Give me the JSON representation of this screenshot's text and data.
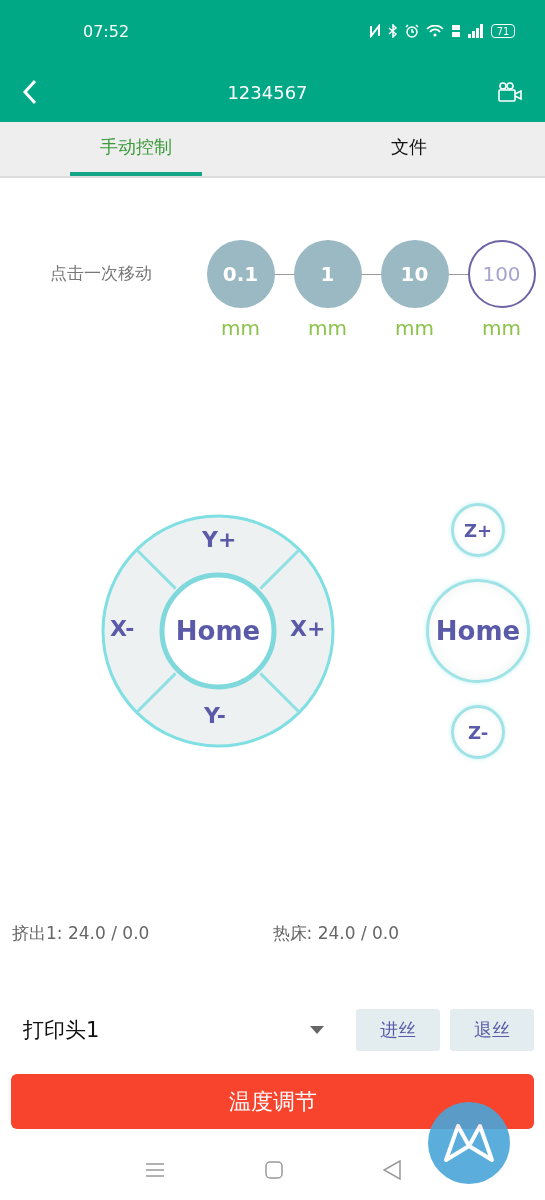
{
  "status_bar": {
    "time": "07:52",
    "battery": "71"
  },
  "app_bar": {
    "title": "1234567"
  },
  "tabs": [
    {
      "label": "手动控制",
      "selected": true
    },
    {
      "label": "文件",
      "selected": false
    }
  ],
  "step_selector": {
    "label": "点击一次移动",
    "steps": [
      {
        "value": "0.1",
        "unit": "mm",
        "selected": false
      },
      {
        "value": "1",
        "unit": "mm",
        "selected": false
      },
      {
        "value": "10",
        "unit": "mm",
        "selected": false
      },
      {
        "value": "100",
        "unit": "mm",
        "selected": true
      }
    ]
  },
  "xy_pad": {
    "home": "Home",
    "directions": [
      {
        "label": "Y+",
        "kind": "top"
      },
      {
        "label": "X-",
        "kind": "left"
      },
      {
        "label": "X+",
        "kind": "right"
      },
      {
        "label": "Y-",
        "kind": "bottom"
      }
    ]
  },
  "z_controls": [
    {
      "label": "Z+",
      "kind": "small"
    },
    {
      "label": "Home",
      "kind": "large"
    },
    {
      "label": "Z-",
      "kind": "small"
    }
  ],
  "temperatures": [
    {
      "label": "挤出1:",
      "value": "24.0 / 0.0"
    },
    {
      "label": "热床:",
      "value": "24.0 / 0.0"
    }
  ],
  "extruder_select": {
    "value": "打印头1"
  },
  "filament_buttons": [
    "进丝",
    "退丝"
  ],
  "temperature_button": "温度调节"
}
